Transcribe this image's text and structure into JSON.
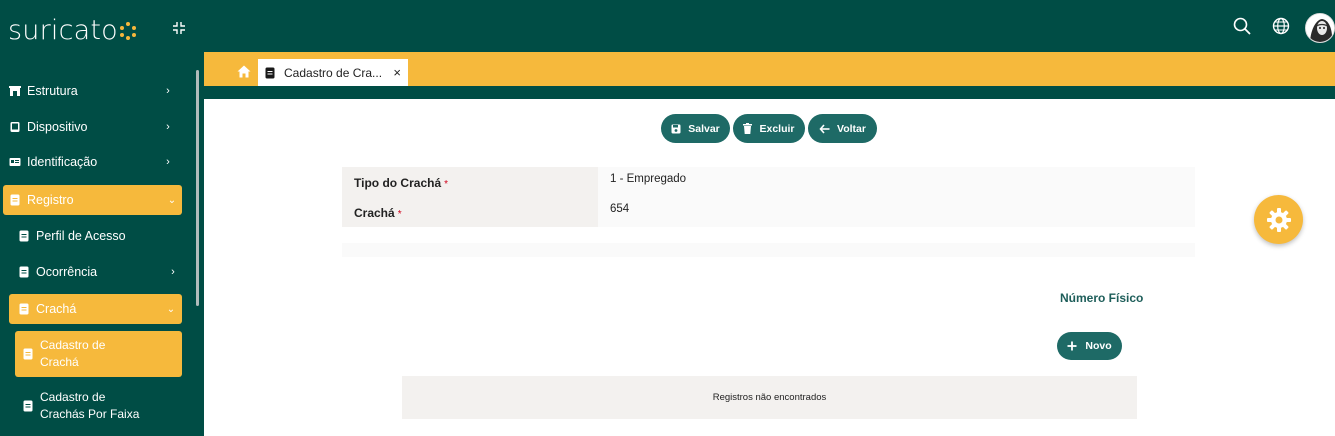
{
  "brand": {
    "name": "suricato"
  },
  "colors": {
    "primary": "#004d45",
    "accent": "#f6b93c",
    "button": "#1e6a66"
  },
  "sidebar": {
    "items": [
      {
        "label": "Estrutura",
        "icon": "building-icon"
      },
      {
        "label": "Dispositivo",
        "icon": "tablet-icon"
      },
      {
        "label": "Identificação",
        "icon": "id-card-icon"
      },
      {
        "label": "Registro",
        "icon": "document-icon"
      },
      {
        "label": "Perfil de Acesso",
        "icon": "document-icon"
      },
      {
        "label": "Ocorrência",
        "icon": "document-icon"
      },
      {
        "label": "Crachá",
        "icon": "document-icon"
      },
      {
        "label_line1": "Cadastro de",
        "label_line2": "Crachá",
        "icon": "document-icon"
      },
      {
        "label_line1": "Cadastro de",
        "label_line2": "Crachás Por Faixa",
        "icon": "document-icon"
      }
    ]
  },
  "tabs": [
    {
      "label": "Cadastro de Cra...",
      "close": "×"
    }
  ],
  "actions": {
    "save": "Salvar",
    "delete": "Excluir",
    "back": "Voltar"
  },
  "form": {
    "fields": [
      {
        "label": "Tipo do Crachá",
        "required": "*",
        "value": "1 - Empregado"
      },
      {
        "label": "Crachá",
        "required": "*",
        "value": "654"
      }
    ]
  },
  "subsection": {
    "column_header": "Número Físico",
    "new_button": "Novo",
    "empty_message": "Registros não encontrados"
  }
}
